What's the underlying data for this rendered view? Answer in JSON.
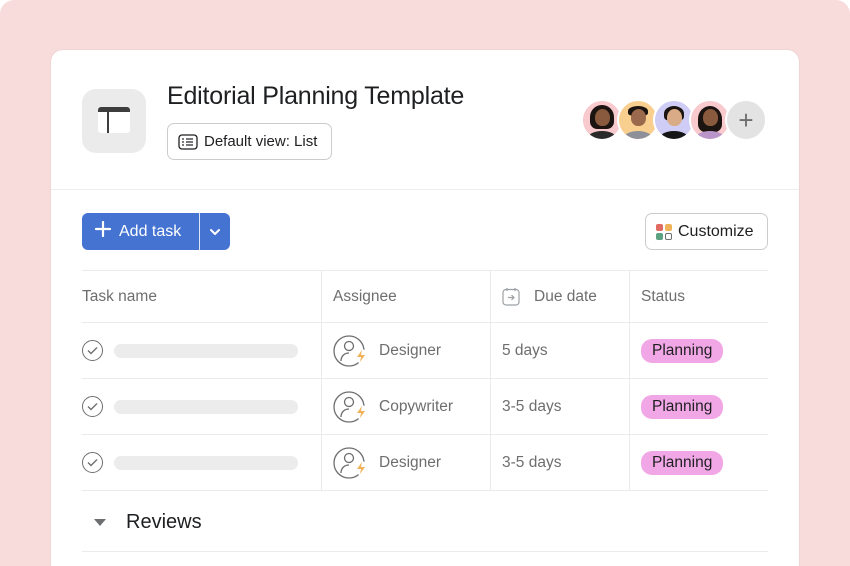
{
  "colors": {
    "background": "#f8dcdc",
    "accent": "#4573d2",
    "status_planning": "#f1a7e6"
  },
  "header": {
    "project_icon": "board-layout-icon",
    "title": "Editorial Planning Template",
    "view_button": {
      "icon": "list-icon",
      "label": "Default view: List"
    },
    "members": [
      {
        "name": "member-1",
        "bg": "#f8c9cd"
      },
      {
        "name": "member-2",
        "bg": "#f9cf8f"
      },
      {
        "name": "member-3",
        "bg": "#cfcdf5"
      },
      {
        "name": "member-4",
        "bg": "#f8c9cd"
      }
    ],
    "add_member_label": "+"
  },
  "toolbar": {
    "add_task_label": "Add task",
    "add_task_icon": "plus-icon",
    "dropdown_icon": "chevron-down-icon",
    "customize_label": "Customize",
    "customize_icon": "customize-grid-icon"
  },
  "table": {
    "columns": [
      {
        "label": "Task name"
      },
      {
        "label": "Assignee"
      },
      {
        "label": "Due date",
        "icon": "calendar-arrow-icon"
      },
      {
        "label": "Status"
      }
    ],
    "rows": [
      {
        "task": "",
        "assignee": "Designer",
        "due": "5 days",
        "status": "Planning"
      },
      {
        "task": "",
        "assignee": "Copywriter",
        "due": "3-5 days",
        "status": "Planning"
      },
      {
        "task": "",
        "assignee": "Designer",
        "due": "3-5 days",
        "status": "Planning"
      }
    ]
  },
  "sections": [
    {
      "label": "Reviews",
      "collapsed": false
    }
  ]
}
